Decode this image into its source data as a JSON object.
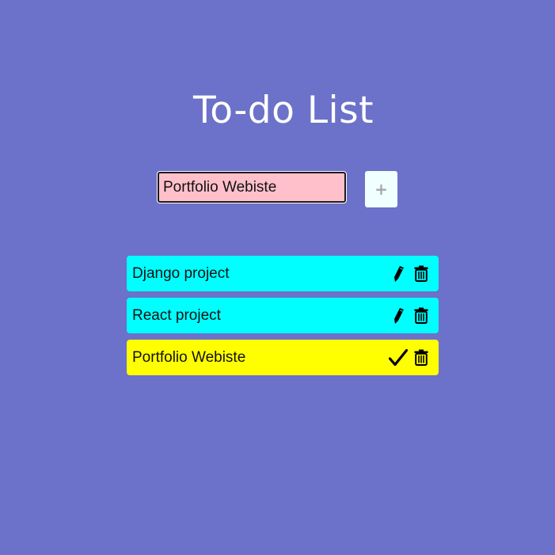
{
  "title": "To-do List",
  "input": {
    "value": "Portfolio Webiste"
  },
  "add_button": {
    "label": "+"
  },
  "todos": [
    {
      "text": "Django project",
      "state": "normal",
      "color": "#00ffff",
      "actions": [
        "pencil-icon",
        "trash-icon"
      ]
    },
    {
      "text": "React project",
      "state": "normal",
      "color": "#00ffff",
      "actions": [
        "pencil-icon",
        "trash-icon"
      ]
    },
    {
      "text": "Portfolio Webiste",
      "state": "editing",
      "color": "#ffff00",
      "actions": [
        "checkmark-icon",
        "trash-icon"
      ]
    }
  ],
  "colors": {
    "background": "#6c71c9",
    "input_bg": "#ffc0cb",
    "add_button_bg": "#f0ffff",
    "item_bg": "#00ffff",
    "editing_item_bg": "#ffff00"
  }
}
